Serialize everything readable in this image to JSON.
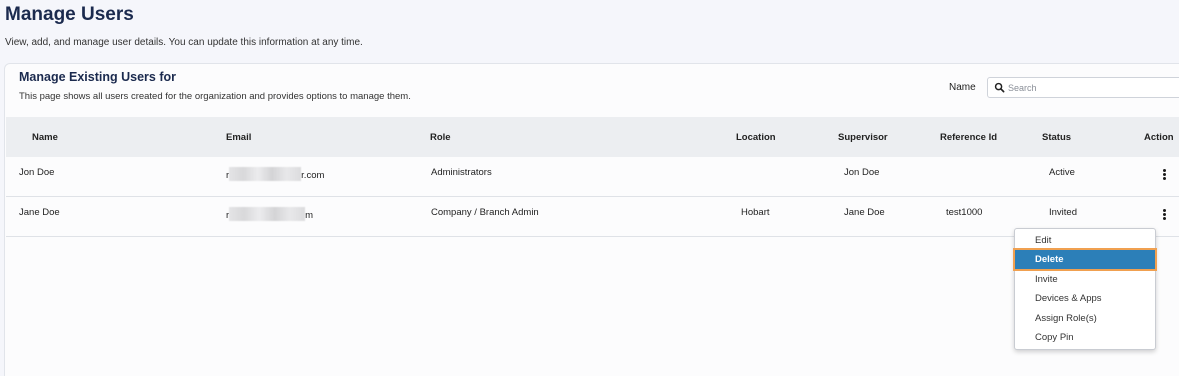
{
  "page": {
    "title": "Manage Users",
    "subtitle": "View, add, and manage user details. You can update this information at any time."
  },
  "card": {
    "title": "Manage Existing Users for",
    "description": "This page shows all users created for the organization and provides options to manage them."
  },
  "search": {
    "label": "Name",
    "placeholder": "Search",
    "icon": "search-icon"
  },
  "table": {
    "columns": [
      "Name",
      "Email",
      "Role",
      "Location",
      "Supervisor",
      "Reference Id",
      "Status",
      "Action"
    ],
    "rows": [
      {
        "name": "Jon Doe",
        "email_prefix": "r",
        "email_suffix": "r.com",
        "role": "Administrators",
        "location": "",
        "supervisor": "Jon Doe",
        "reference_id": "",
        "status": "Active"
      },
      {
        "name": "Jane Doe",
        "email_prefix": "r",
        "email_suffix": "m",
        "role": "Company / Branch Admin",
        "location": "Hobart",
        "supervisor": "Jane Doe",
        "reference_id": "test1000",
        "status": "Invited"
      }
    ]
  },
  "action_menu": {
    "items": [
      "Edit",
      "Delete",
      "Invite",
      "Devices & Apps",
      "Assign Role(s)",
      "Copy Pin"
    ],
    "highlighted": "Delete"
  },
  "colors": {
    "title": "#1b2a4e",
    "highlight": "#2c7fb8",
    "highlight_outline": "#f0a050",
    "header_bg": "#eceef1"
  }
}
